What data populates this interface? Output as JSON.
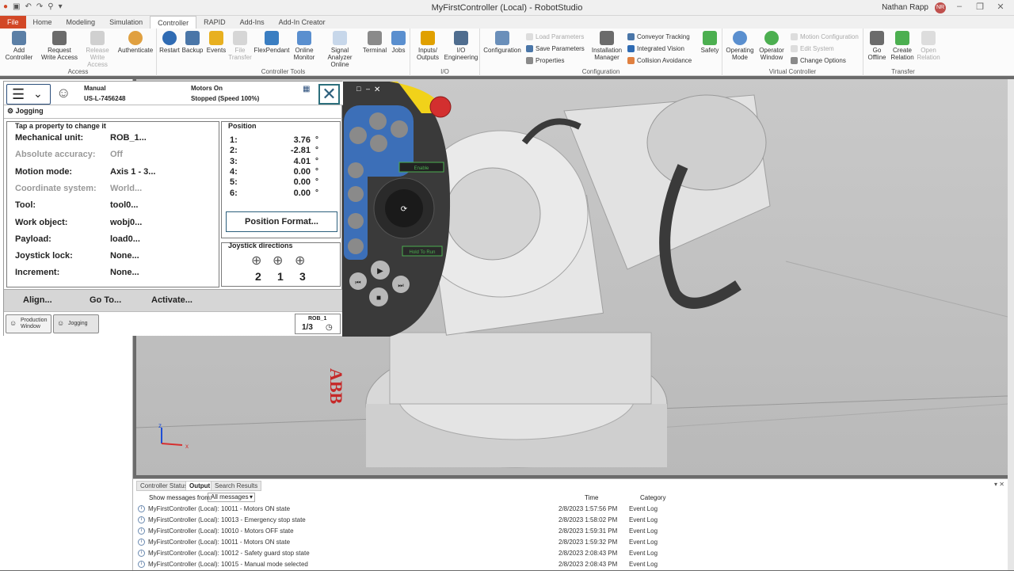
{
  "window": {
    "title": "MyFirstController (Local) - RobotStudio",
    "user": "Nathan Rapp",
    "user_initials": "NR"
  },
  "ribbon_tabs": [
    "File",
    "Home",
    "Modeling",
    "Simulation",
    "Controller",
    "RAPID",
    "Add-Ins",
    "Add-In Creator"
  ],
  "ribbon": {
    "access": {
      "label": "Access",
      "add_controller": "Add Controller",
      "request_write": "Request Write Access",
      "release_write": "Release Write Access",
      "authenticate": "Authenticate"
    },
    "tools": {
      "label": "Controller Tools",
      "restart": "Restart",
      "backup": "Backup",
      "events": "Events",
      "file_transfer": "File Transfer",
      "flexpendant": "FlexPendant",
      "online_monitor": "Online Monitor",
      "signal_analyzer": "Signal Analyzer Online",
      "terminal": "Terminal",
      "jobs": "Jobs"
    },
    "io": {
      "label": "I/O",
      "inputs_outputs": "Inputs/ Outputs",
      "io_engineering": "I/O Engineering"
    },
    "configuration": {
      "label": "Configuration",
      "configuration": "Configuration",
      "load_parameters": "Load Parameters",
      "save_parameters": "Save Parameters",
      "properties": "Properties",
      "installation_manager": "Installation Manager",
      "conveyor_tracking": "Conveyor Tracking",
      "integrated_vision": "Integrated Vision",
      "collision_avoidance": "Collision Avoidance",
      "safety": "Safety"
    },
    "virtual": {
      "label": "Virtual Controller",
      "operating_mode": "Operating Mode",
      "operator_window": "Operator Window",
      "motion_configuration": "Motion Configuration",
      "edit_system": "Edit System",
      "change_options": "Change Options"
    },
    "transfer": {
      "label": "Transfer",
      "go_offline": "Go Offline",
      "create_relation": "Create Relation",
      "open_relation": "Open Relation"
    }
  },
  "flexpendant": {
    "mode": "Manual",
    "controller_id": "US-L-7456248",
    "motors": "Motors On",
    "speed_status": "Stopped (Speed 100%)",
    "app_title": "Jogging",
    "properties_header": "Tap a property to change it",
    "properties": [
      {
        "label": "Mechanical unit:",
        "value": "ROB_1..."
      },
      {
        "label": "Absolute accuracy:",
        "value": "Off"
      },
      {
        "label": "Motion mode:",
        "value": "Axis 1 - 3..."
      },
      {
        "label": "Coordinate system:",
        "value": "World..."
      },
      {
        "label": "Tool:",
        "value": "tool0..."
      },
      {
        "label": "Work object:",
        "value": "wobj0..."
      },
      {
        "label": "Payload:",
        "value": "load0..."
      },
      {
        "label": "Joystick lock:",
        "value": "None..."
      },
      {
        "label": "Increment:",
        "value": "None..."
      }
    ],
    "position_header": "Position",
    "positions": [
      {
        "axis": "1:",
        "value": "3.76",
        "unit": "°"
      },
      {
        "axis": "2:",
        "value": "-2.81",
        "unit": "°"
      },
      {
        "axis": "3:",
        "value": "4.01",
        "unit": "°"
      },
      {
        "axis": "4:",
        "value": "0.00",
        "unit": "°"
      },
      {
        "axis": "5:",
        "value": "0.00",
        "unit": "°"
      },
      {
        "axis": "6:",
        "value": "0.00",
        "unit": "°"
      }
    ],
    "position_format": "Position Format...",
    "joystick_header": "Joystick directions",
    "joystick_numbers": [
      "2",
      "1",
      "3"
    ],
    "commands": [
      "Align...",
      "Go To...",
      "Activate..."
    ],
    "taskbar": {
      "production_window": "Production Window",
      "jogging": "Jogging",
      "unit": "ROB_1",
      "fraction": "1/3"
    }
  },
  "device": {
    "enable": "Enable",
    "hold_to_run": "Hold To Run"
  },
  "output": {
    "tabs": [
      "Controller Status",
      "Output",
      "Search Results"
    ],
    "filter_label": "Show messages from:",
    "filter_value": "All messages",
    "col_time": "Time",
    "col_category": "Category",
    "rows": [
      {
        "msg": "MyFirstController (Local): 10011 - Motors ON state",
        "time": "2/8/2023 1:57:56 PM",
        "cat": "Event Log"
      },
      {
        "msg": "MyFirstController (Local): 10013 - Emergency stop state",
        "time": "2/8/2023 1:58:02 PM",
        "cat": "Event Log"
      },
      {
        "msg": "MyFirstController (Local): 10010 - Motors OFF state",
        "time": "2/8/2023 1:59:31 PM",
        "cat": "Event Log"
      },
      {
        "msg": "MyFirstController (Local): 10011 - Motors ON state",
        "time": "2/8/2023 1:59:32 PM",
        "cat": "Event Log"
      },
      {
        "msg": "MyFirstController (Local): 10012 - Safety guard stop state",
        "time": "2/8/2023 2:08:43 PM",
        "cat": "Event Log"
      },
      {
        "msg": "MyFirstController (Local): 10015 - Manual mode selected",
        "time": "2/8/2023 2:08:43 PM",
        "cat": "Event Log"
      }
    ]
  },
  "scene": {
    "logo_text": "ABB",
    "axis_x": "x",
    "axis_z": "z"
  },
  "colors": {
    "file_tab": "#d24726",
    "robot": "#e6e6e6",
    "emergency_stop": "#d32f2f",
    "pendant_frame": "#3a3a3a",
    "pendant_accent": "#f1d21a"
  }
}
